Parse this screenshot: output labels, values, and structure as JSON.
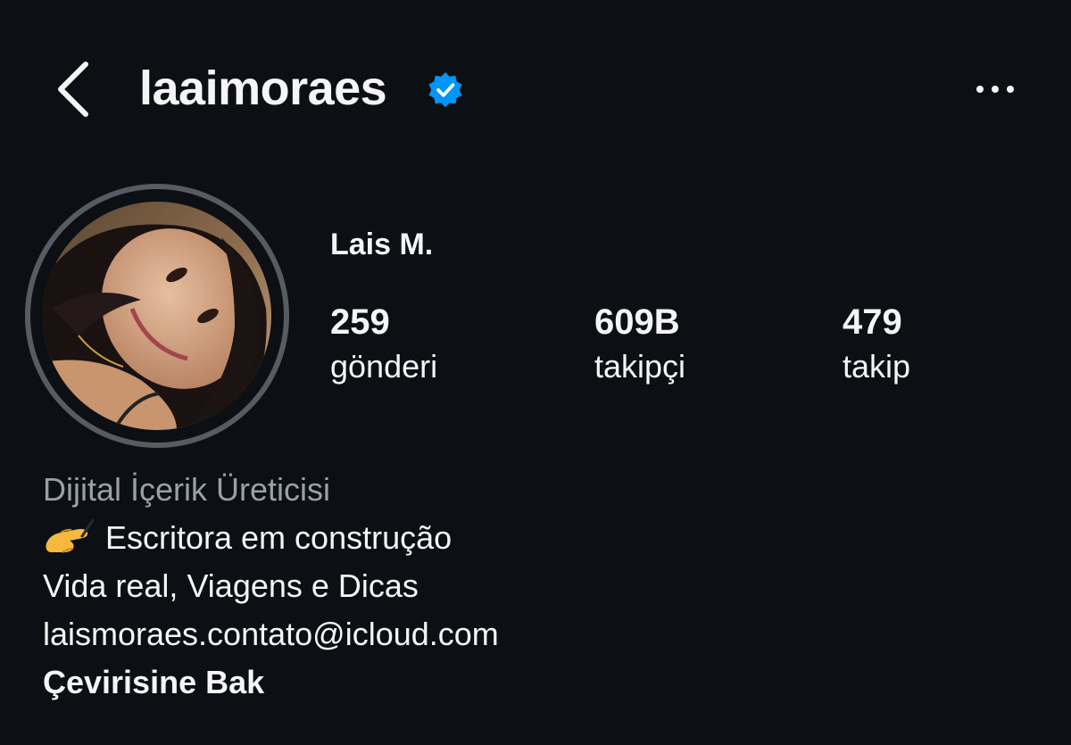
{
  "header": {
    "username": "laaimoraes",
    "verified_color": "#0095f6",
    "back_icon": "chevron-left-icon",
    "more_icon": "more-horizontal-icon"
  },
  "profile": {
    "display_name": "Lais M.",
    "stats": [
      {
        "value": "259",
        "label": "gönderi"
      },
      {
        "value": "609B",
        "label": "takipçi"
      },
      {
        "value": "479",
        "label": "takip"
      }
    ]
  },
  "bio": {
    "category": "Dijital İçerik Üreticisi",
    "line1_emoji": "writing-hand-icon",
    "line1_text": "Escritora em construção",
    "line2": "Vida real, Viagens e Dicas",
    "line3": "laismoraes.contato@icloud.com",
    "translate_label": "Çevirisine Bak"
  },
  "colors": {
    "background": "#0c1014",
    "text": "#f5f5f5",
    "muted": "#9aa0a8",
    "ring": "#575b62"
  }
}
